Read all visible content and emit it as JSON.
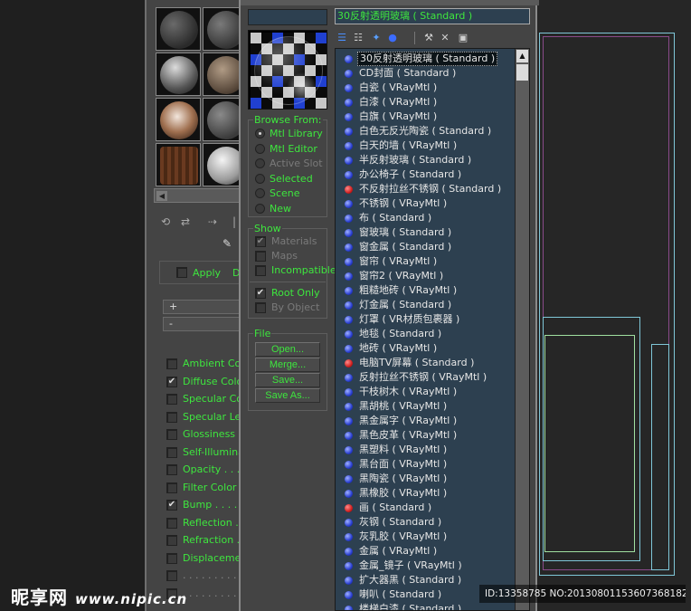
{
  "material_editor": {
    "apply_label": "Apply",
    "apply_partial": "D",
    "rollout_plus": "+",
    "rollout_minus": "-",
    "maps": [
      {
        "label": "Ambient Colo",
        "checked": false
      },
      {
        "label": "Diffuse Color",
        "checked": true
      },
      {
        "label": "Specular Colo",
        "checked": false
      },
      {
        "label": "Specular Lev",
        "checked": false
      },
      {
        "label": "Glossiness .",
        "checked": false
      },
      {
        "label": "Self-Illumina",
        "checked": false
      },
      {
        "label": "Opacity . . .",
        "checked": false
      },
      {
        "label": "Filter Color .",
        "checked": false
      },
      {
        "label": "Bump . . . . .",
        "checked": true
      },
      {
        "label": "Reflection . .",
        "checked": false
      },
      {
        "label": "Refraction . .",
        "checked": false
      },
      {
        "label": "Displacement",
        "checked": false
      },
      {
        "label": ". . . . . . . . .",
        "checked": false
      },
      {
        "label": ". . . . . . . . .",
        "checked": false
      }
    ]
  },
  "browser": {
    "current_material": "30反射透明玻璃 ( Standard )",
    "browse_from": {
      "title": "Browse From:",
      "options": [
        {
          "label": "Mtl Library",
          "selected": true,
          "enabled": true
        },
        {
          "label": "Mtl Editor",
          "selected": false,
          "enabled": true
        },
        {
          "label": "Active Slot",
          "selected": false,
          "enabled": false
        },
        {
          "label": "Selected",
          "selected": false,
          "enabled": true
        },
        {
          "label": "Scene",
          "selected": false,
          "enabled": true
        },
        {
          "label": "New",
          "selected": false,
          "enabled": true
        }
      ]
    },
    "show": {
      "title": "Show",
      "options": [
        {
          "label": "Materials",
          "checked": true,
          "enabled": false
        },
        {
          "label": "Maps",
          "checked": false,
          "enabled": false
        },
        {
          "label": "Incompatible",
          "checked": false,
          "enabled": true
        },
        {
          "label": "Root Only",
          "checked": true,
          "enabled": true
        },
        {
          "label": "By Object",
          "checked": false,
          "enabled": false
        }
      ]
    },
    "file": {
      "title": "File",
      "buttons": [
        "Open...",
        "Merge...",
        "Save...",
        "Save As..."
      ]
    },
    "materials": [
      {
        "name": "30反射透明玻璃 ( Standard )",
        "kind": "blue",
        "selected": true
      },
      {
        "name": "CD封面 ( Standard )",
        "kind": "blue"
      },
      {
        "name": "白瓷 ( VRayMtl )",
        "kind": "blue"
      },
      {
        "name": "白漆 ( VRayMtl )",
        "kind": "blue"
      },
      {
        "name": "白旗 ( VRayMtl )",
        "kind": "blue"
      },
      {
        "name": "白色无反光陶瓷 ( Standard )",
        "kind": "blue"
      },
      {
        "name": "白天的墙 ( VRayMtl )",
        "kind": "blue"
      },
      {
        "name": "半反射玻璃 ( Standard )",
        "kind": "blue"
      },
      {
        "name": "办公椅子 ( Standard )",
        "kind": "blue"
      },
      {
        "name": "不反射拉丝不锈钢 ( Standard )",
        "kind": "red"
      },
      {
        "name": "不锈钢 ( VRayMtl )",
        "kind": "blue"
      },
      {
        "name": "布 ( Standard )",
        "kind": "blue"
      },
      {
        "name": "窗玻璃 ( Standard )",
        "kind": "blue"
      },
      {
        "name": "窗金属 ( Standard )",
        "kind": "blue"
      },
      {
        "name": "窗帘 ( VRayMtl )",
        "kind": "blue"
      },
      {
        "name": "窗帘2 ( VRayMtl )",
        "kind": "blue"
      },
      {
        "name": "粗糙地砖 ( VRayMtl )",
        "kind": "blue"
      },
      {
        "name": "灯金属 ( Standard )",
        "kind": "blue"
      },
      {
        "name": "灯罩 ( VR材质包裹器 )",
        "kind": "blue"
      },
      {
        "name": "地毯 ( Standard )",
        "kind": "blue"
      },
      {
        "name": "地砖 ( VRayMtl )",
        "kind": "blue"
      },
      {
        "name": "电脑TV屏幕 ( Standard )",
        "kind": "red"
      },
      {
        "name": "反射拉丝不锈钢 ( VRayMtl )",
        "kind": "blue"
      },
      {
        "name": "干枝树木 ( VRayMtl )",
        "kind": "blue"
      },
      {
        "name": "黑胡桃 ( VRayMtl )",
        "kind": "blue"
      },
      {
        "name": "黑金属字 ( VRayMtl )",
        "kind": "blue"
      },
      {
        "name": "黑色皮革 ( VRayMtl )",
        "kind": "blue"
      },
      {
        "name": "黑塑料 ( VRayMtl )",
        "kind": "blue"
      },
      {
        "name": "黑台面 ( VRayMtl )",
        "kind": "blue"
      },
      {
        "name": "黑陶瓷 ( VRayMtl )",
        "kind": "blue"
      },
      {
        "name": "黑橡胶 ( VRayMtl )",
        "kind": "blue"
      },
      {
        "name": "画 ( Standard )",
        "kind": "red"
      },
      {
        "name": "灰钢 ( Standard )",
        "kind": "blue"
      },
      {
        "name": "灰乳胶 ( VRayMtl )",
        "kind": "blue"
      },
      {
        "name": "金属 ( VRayMtl )",
        "kind": "blue"
      },
      {
        "name": "金属_镜子 ( VRayMtl )",
        "kind": "blue"
      },
      {
        "name": "扩大器黑 ( Standard )",
        "kind": "blue"
      },
      {
        "name": "喇叭 ( Standard )",
        "kind": "blue"
      },
      {
        "name": "楼梯白漆 ( Standard )",
        "kind": "blue"
      }
    ]
  },
  "watermark": {
    "brand": "昵享网",
    "url": "www.nipic.cn",
    "id_text": "ID:13358785 NO:20130801153607368182"
  },
  "colors": {
    "green_label": "#3ee63e",
    "list_bg": "#2d4050",
    "dot_blue": "#2a3fd1",
    "dot_red": "#d02020"
  }
}
